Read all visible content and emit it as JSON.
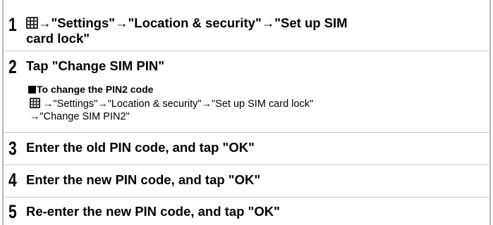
{
  "steps": [
    {
      "number": "1",
      "icon": "apps-grid-icon",
      "line1": "→\"Settings\"→\"Location & security\"→\"Set up SIM",
      "line2": "card lock\""
    },
    {
      "number": "2",
      "text": "Tap \"Change SIM PIN\""
    },
    {
      "number": "3",
      "text": "Enter the old PIN code, and tap \"OK\""
    },
    {
      "number": "4",
      "text": "Enter the new PIN code, and tap \"OK\""
    },
    {
      "number": "5",
      "text": "Re-enter the new PIN code, and tap \"OK\""
    }
  ],
  "pin2": {
    "heading": "To change the PIN2 code",
    "icon": "apps-grid-icon",
    "line1": "→\"Settings\"→\"Location & security\"→\"Set up SIM card lock\"",
    "line2": "→\"Change SIM PIN2\""
  },
  "colors": {
    "frame": "#b5b5b5",
    "divider": "#cfcfcf",
    "text": "#000000"
  }
}
